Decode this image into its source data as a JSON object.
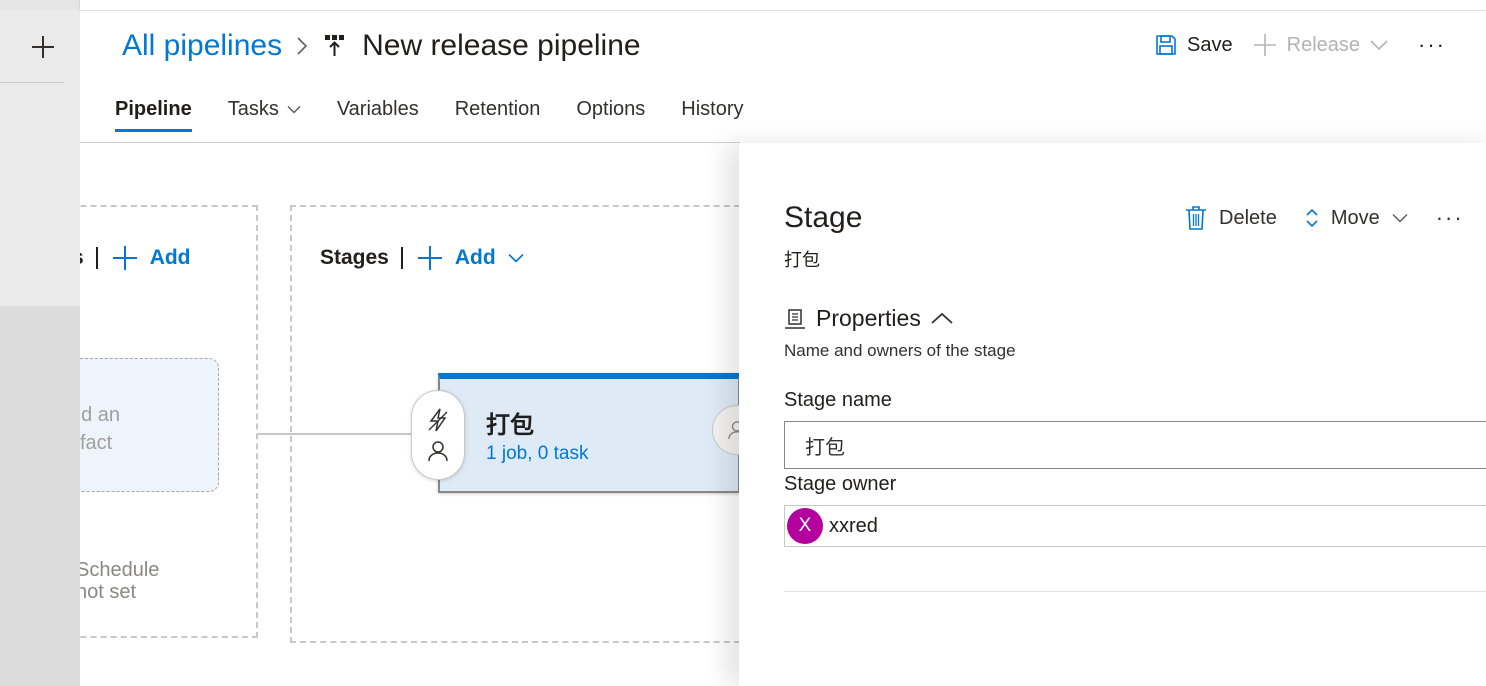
{
  "breadcrumb": {
    "root": "All pipelines",
    "title": "New release pipeline"
  },
  "header": {
    "save_label": "Save",
    "release_label": "Release",
    "more_label": "···"
  },
  "tabs": [
    {
      "label": "Pipeline",
      "active": true
    },
    {
      "label": "Tasks",
      "dropdown": true
    },
    {
      "label": "Variables"
    },
    {
      "label": "Retention"
    },
    {
      "label": "Options"
    },
    {
      "label": "History"
    }
  ],
  "artifacts": {
    "header_partial": "s",
    "add_label": "Add",
    "card_line1": "dd an",
    "card_line2": "tifact",
    "schedule_line1": "Schedule",
    "schedule_line2": "not set"
  },
  "stages": {
    "header": "Stages",
    "add_label": "Add",
    "card": {
      "name": "打包",
      "subtitle": "1 job, 0 task"
    }
  },
  "panel": {
    "title": "Stage",
    "subtitle": "打包",
    "delete_label": "Delete",
    "move_label": "Move",
    "more_label": "···",
    "properties_title": "Properties",
    "properties_desc": "Name and owners of the stage",
    "stage_name_label": "Stage name",
    "stage_name_value": "打包",
    "stage_owner_label": "Stage owner",
    "owner_initial": "X",
    "owner_name": "xxred"
  },
  "colors": {
    "accent": "#0078d4",
    "avatar": "#b4009e",
    "stage_bg": "#deeaf6"
  }
}
